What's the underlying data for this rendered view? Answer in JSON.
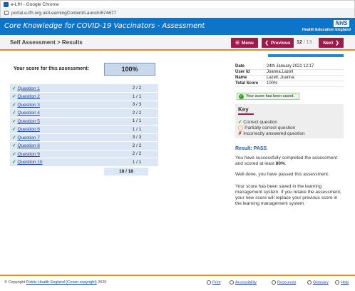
{
  "browser": {
    "window_title": "e-LfH - Google Chrome",
    "url": "portal.e-lfh.org.uk/LearningContent/Launch/674677"
  },
  "header": {
    "title": "Core Knowledge for COVID-19 Vaccinators - Assessment",
    "logo_text": "NHS",
    "logo_subtitle": "Health Education England"
  },
  "toolbar": {
    "breadcrumb": "Self Assessment > Results",
    "menu_label": "Menu",
    "previous_label": "Previous",
    "next_label": "Next",
    "page_current": "12",
    "page_total": "/ 13"
  },
  "results": {
    "score_label": "Your score for this assessment:",
    "score_value": "100%",
    "questions": [
      {
        "label": "Question 1",
        "score": "2 / 2"
      },
      {
        "label": "Question 2",
        "score": "1 / 1"
      },
      {
        "label": "Question 3",
        "score": "3 / 3"
      },
      {
        "label": "Question 4",
        "score": "2 / 2"
      },
      {
        "label": "Question 5",
        "score": "1 / 1"
      },
      {
        "label": "Question 6",
        "score": "1 / 1"
      },
      {
        "label": "Question 7",
        "score": "3 / 3"
      },
      {
        "label": "Question 8",
        "score": "2 / 2"
      },
      {
        "label": "Question 9",
        "score": "2 / 2"
      },
      {
        "label": "Question 10",
        "score": "1 / 1"
      }
    ],
    "total": "18 / 18"
  },
  "progress_fraction": 1,
  "info": {
    "date_label": "Date",
    "date_value": "24th January 2021 12:17",
    "userid_label": "User Id",
    "userid_value": "Joanna.Lazell",
    "name_label": "Name",
    "name_value": "Lazell, Joanna",
    "total_label": "Total Score",
    "total_value": "100%"
  },
  "saved_message": "Your score has been saved.",
  "key": {
    "title": "Key",
    "correct": "Correct question",
    "partial": "Partially correct question",
    "incorrect": "Incorrectly answered question"
  },
  "result_heading": "Result: PASS",
  "para1_a": "You have successfully completed the assessment and scored at least ",
  "para1_b": "80%",
  "para1_c": ".",
  "para2": "Well done, you have passed this assessment.",
  "para3": "Your score has been saved in the learning management system. If you retake the assessment, your new score will replace your previous score in the learning management system.",
  "footer": {
    "copyright_prefix": "© Copyright ",
    "copyright_link": "Public Health England (Crown copyright)",
    "copyright_year": " 2020",
    "links": [
      "Print",
      "Accessibility",
      "Resources",
      "Glossary",
      "Help"
    ]
  },
  "colors": {
    "header_blue": "#0d74c8",
    "button_maroon": "#9c1b4a",
    "accent_orange": "#e48b24"
  }
}
